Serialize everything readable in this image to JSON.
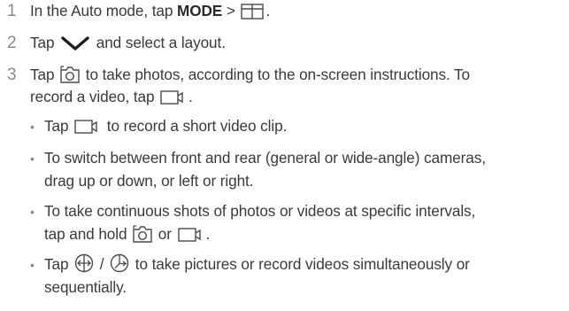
{
  "steps": [
    {
      "num": "1",
      "pre": "In the Auto mode, tap ",
      "bold": "MODE",
      "sep": " > ",
      "post": "."
    },
    {
      "num": "2",
      "pre": "Tap ",
      "post": " and select a layout."
    },
    {
      "num": "3",
      "pre": "Tap ",
      "mid": " to take photos, according to the on-screen instructions. To",
      "line2": "record a video, tap ",
      "post": "."
    }
  ],
  "bullets": [
    {
      "pre": "Tap ",
      "post": " to record a short video clip."
    },
    {
      "line1": "To switch between front and rear (general or wide-angle) cameras,",
      "line2": "drag up or down, or left or right."
    },
    {
      "line1": "To take continuous shots of photos or videos at specific intervals,",
      "line2a": "tap and hold ",
      "or": " or ",
      "post": "."
    },
    {
      "pre": "Tap ",
      "slash": " / ",
      "post": " to take pictures or record videos simultaneously or",
      "line2": "sequentially."
    }
  ],
  "icons": {
    "layout": "layout-grid-icon",
    "chevron": "chevron-down-icon",
    "camera": "camera-icon",
    "video": "video-camera-icon",
    "simultaneous": "simultaneous-mode-icon",
    "sequential": "sequential-mode-icon"
  },
  "colors": {
    "text": "#3a3a3a",
    "number": "#8a8a8a",
    "chevron": "#1c1c1c"
  }
}
